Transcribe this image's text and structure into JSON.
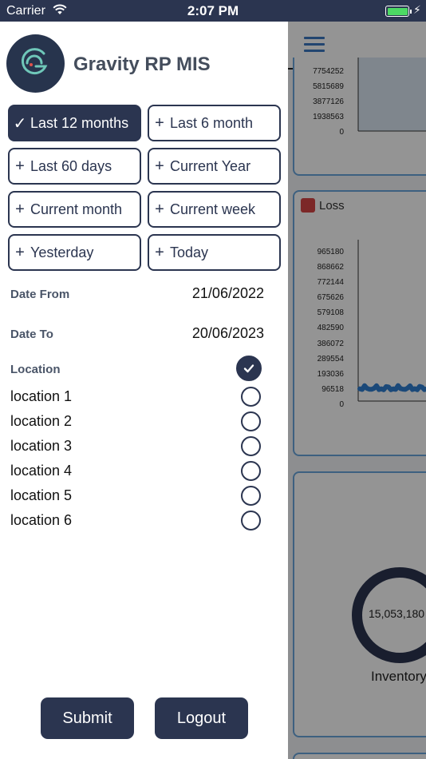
{
  "status_bar": {
    "carrier": "Carrier",
    "time": "2:07 PM"
  },
  "app": {
    "title": "Gravity RP MIS"
  },
  "filters": [
    {
      "label": "Last 12 months",
      "selected": true
    },
    {
      "label": "Last 6 month",
      "selected": false
    },
    {
      "label": "Last 60 days",
      "selected": false
    },
    {
      "label": "Current Year",
      "selected": false
    },
    {
      "label": "Current month",
      "selected": false
    },
    {
      "label": "Current week",
      "selected": false
    },
    {
      "label": "Yesterday",
      "selected": false
    },
    {
      "label": "Today",
      "selected": false
    }
  ],
  "glyphs": {
    "selected": "✓",
    "unselected": "+"
  },
  "date_from": {
    "label": "Date From",
    "value": "21/06/2022"
  },
  "date_to": {
    "label": "Date To",
    "value": "20/06/2023"
  },
  "location": {
    "label": "Location",
    "all_checked": true,
    "items": [
      {
        "label": "location 1",
        "checked": false
      },
      {
        "label": "location 2",
        "checked": false
      },
      {
        "label": "location 3",
        "checked": false
      },
      {
        "label": "location 4",
        "checked": false
      },
      {
        "label": "location 5",
        "checked": false
      },
      {
        "label": "location 6",
        "checked": false
      }
    ]
  },
  "actions": {
    "submit": "Submit",
    "logout": "Logout"
  },
  "background": {
    "card1_ticks": [
      "7754252",
      "5815689",
      "3877126",
      "1938563",
      "0"
    ],
    "loss_legend": "Loss",
    "loss_ticks": [
      "965180",
      "868662",
      "772144",
      "675626",
      "579108",
      "482590",
      "386072",
      "289554",
      "193036",
      "96518",
      "0"
    ],
    "inventory_value": "15,053,180",
    "inventory_label": "Inventory"
  },
  "colors": {
    "primary": "#2b3550",
    "accent": "#3b78c2",
    "loss": "#d64545",
    "battery": "#4cd964"
  },
  "icons": [
    "wifi-icon",
    "battery-icon",
    "charging-icon",
    "menu-icon",
    "logo-icon",
    "checkmark-icon",
    "plus-icon"
  ]
}
